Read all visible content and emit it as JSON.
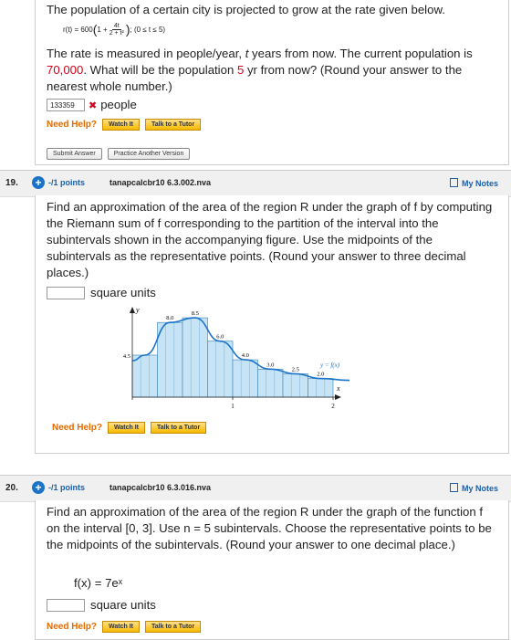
{
  "q18": {
    "intro": "The population of a certain city is projected to grow at the rate given below.",
    "formula_lhs": "r(t) = 600",
    "formula_mid": "1 +",
    "frac_num": "4t",
    "frac_den": "2 + t²",
    "formula_domain": "; (0 ≤ t ≤ 5)",
    "para_1": "The rate is measured in people/year, ",
    "para_t": "t",
    "para_2": " years from now. The current population is ",
    "para_pop": "70,000",
    "para_3": ". What will be the population ",
    "para_yrs": "5",
    "para_4": " yr from now? (Round your answer to the nearest whole number.)",
    "answer_value": "133359",
    "wrong_mark": "✖",
    "units": "people",
    "need_help": "Need Help?",
    "watch_label": "Watch It",
    "tutor_label": "Talk to a Tutor",
    "submit_label": "Submit Answer",
    "practice_label": "Practice Another Version"
  },
  "q19": {
    "number": "19.",
    "points": "-/1 points",
    "code": "tanapcalcbr10 6.3.002.nva",
    "notes": "My Notes",
    "text": "Find an approximation of the area of the region R under the graph of f by computing the Riemann sum of f corresponding to the partition of the interval into the subintervals shown in the accompanying figure. Use the midpoints of the subintervals as the representative points. (Round your answer to three decimal places.)",
    "units": "square units",
    "need_help": "Need Help?",
    "watch_label": "Watch It",
    "tutor_label": "Talk to a Tutor"
  },
  "chart_data": {
    "type": "bar",
    "values": [
      4.5,
      8.0,
      8.5,
      6.0,
      4.0,
      3.0,
      2.5,
      2.0
    ],
    "value_labels": [
      "4.5",
      "8.0",
      "8.5",
      "6.0",
      "4.0",
      "3.0",
      "2.5",
      "2.0"
    ],
    "xlim": [
      0,
      2
    ],
    "ylim": [
      0,
      9
    ],
    "xticks": [
      "1",
      "2"
    ],
    "xlabel": "x",
    "ylabel": "y",
    "curve_label": "y = f(x)"
  },
  "q20": {
    "number": "20.",
    "points": "-/1 points",
    "code": "tanapcalcbr10 6.3.016.nva",
    "notes": "My Notes",
    "text": "Find an approximation of the area of the region R under the graph of the function f on the interval [0, 3]. Use n = 5 subintervals. Choose the representative points to be the midpoints of the subintervals. (Round your answer to one decimal place.)",
    "function": "f(x) = 7eˣ",
    "units": "square units",
    "need_help": "Need Help?",
    "watch_label": "Watch It",
    "tutor_label": "Talk to a Tutor"
  },
  "colors": {
    "accent": "#1a73c9",
    "error": "#d0021b",
    "help": "#e06b00",
    "bar_fill": "#c6e4f5",
    "bar_stroke": "#4a90c2"
  }
}
